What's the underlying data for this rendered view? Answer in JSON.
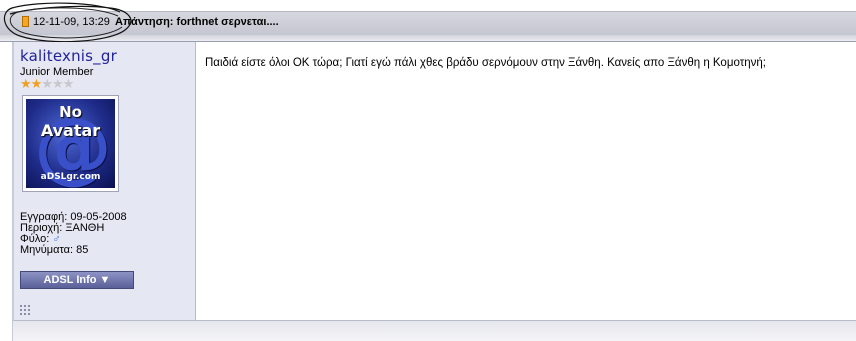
{
  "post": {
    "date": "12-11-09, 13:29",
    "title": "Απάντηση: forthnet σερνεται....",
    "message": "Παιδιά είστε όλοι ΟΚ τώρα; Γιατί εγώ πάλι χθες βράδυ σερνόμουν στην Ξάνθη. Κανείς απο Ξάνθη η Κομοτηνή;"
  },
  "user": {
    "username": "kalitexnis_gr",
    "title": "Junior Member",
    "rating": {
      "filled": 2,
      "total": 5
    },
    "avatar": {
      "line1": "No",
      "line2": "Avatar",
      "symbol": "@",
      "site": "aDSLgr.com"
    },
    "joined": "Εγγραφή: 09-05-2008",
    "location": "Περιοχή: ΞΑΝΘΗ",
    "gender_label": "Φύλο:",
    "gender_symbol": "♂",
    "posts": "Μηνύματα: 85",
    "adsl_button": "ADSL Info ▼"
  },
  "colors": {
    "username": "#22229a",
    "user_column_bg": "#e5e7f3",
    "star_on": "#f0a020",
    "star_off": "#c8c8cc",
    "button_bg": "#5a6098"
  },
  "icons": {
    "post_status": "post-status-icon",
    "gender": "male-gender-icon",
    "resize_grip": "grip-icon"
  }
}
